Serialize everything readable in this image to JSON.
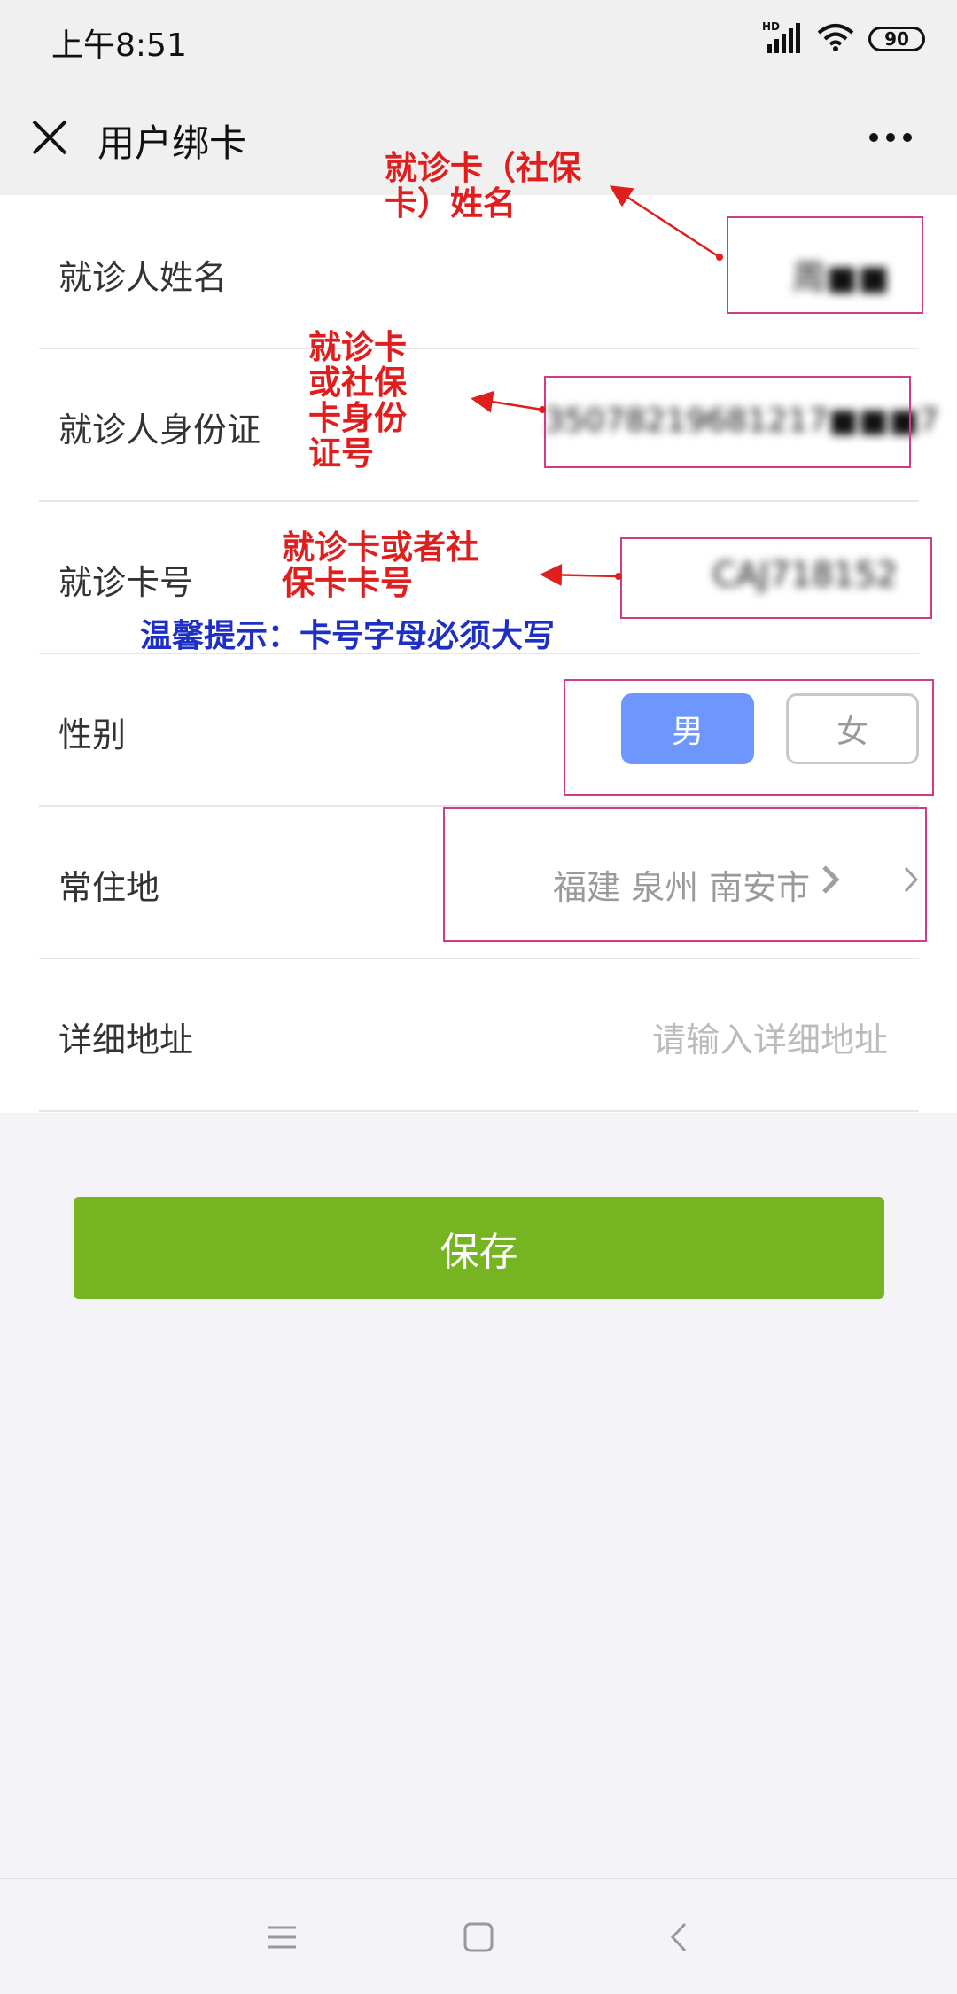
{
  "status_bar": {
    "time": "上午8:51",
    "network": "HD",
    "battery": "90"
  },
  "nav": {
    "title": "用户绑卡"
  },
  "form": {
    "name": {
      "label": "就诊人姓名",
      "value": "周■■"
    },
    "id_card": {
      "label": "就诊人身份证",
      "value": "35078219681217■■■7"
    },
    "card_no": {
      "label": "就诊卡号",
      "value": "CAJ718152"
    },
    "gender": {
      "label": "性别",
      "male": "男",
      "female": "女",
      "selected": "男"
    },
    "residence": {
      "label": "常住地",
      "value": "福建 泉州 南安市"
    },
    "address": {
      "label": "详细地址",
      "placeholder": "请输入详细地址"
    }
  },
  "annotations": {
    "name_note": [
      "就诊卡（社保",
      "卡）姓名"
    ],
    "id_note": [
      "就诊卡",
      "或社保",
      "卡身份",
      "证号"
    ],
    "card_note": [
      "就诊卡或者社",
      "保卡卡号"
    ],
    "tip": "温馨提示：卡号字母必须大写"
  },
  "save_button": {
    "label": "保存"
  },
  "colors": {
    "save_green": "#77b422",
    "male_blue": "#6d97ff",
    "annotation_red": "#e01e1e",
    "tip_blue": "#1d2fc4",
    "box_magenta": "#d23a8a"
  }
}
